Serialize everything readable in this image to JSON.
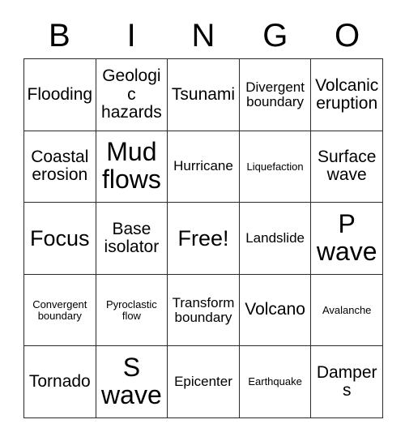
{
  "header": {
    "letters": [
      "B",
      "I",
      "N",
      "G",
      "O"
    ]
  },
  "grid": {
    "rows": 5,
    "columns": 5,
    "border_color": "#2b2b2b",
    "background_color": "#ffffff",
    "text_color": "#000000",
    "cells": [
      {
        "text": "Flooding",
        "size": "md"
      },
      {
        "text": "Geologic hazards",
        "size": "md"
      },
      {
        "text": "Tsunami",
        "size": "md"
      },
      {
        "text": "Divergent boundary",
        "size": "sm"
      },
      {
        "text": "Volcanic eruption",
        "size": "md"
      },
      {
        "text": "Coastal erosion",
        "size": "md"
      },
      {
        "text": "Mud flows",
        "size": "xl"
      },
      {
        "text": "Hurricane",
        "size": "sm"
      },
      {
        "text": "Liquefaction",
        "size": "xs"
      },
      {
        "text": "Surface wave",
        "size": "md"
      },
      {
        "text": "Focus",
        "size": "lg"
      },
      {
        "text": "Base isolator",
        "size": "md"
      },
      {
        "text": "Free!",
        "size": "lg"
      },
      {
        "text": "Landslide",
        "size": "sm"
      },
      {
        "text": "P wave",
        "size": "xl"
      },
      {
        "text": "Convergent boundary",
        "size": "xs"
      },
      {
        "text": "Pyroclastic flow",
        "size": "xs"
      },
      {
        "text": "Transform boundary",
        "size": "sm"
      },
      {
        "text": "Volcano",
        "size": "md"
      },
      {
        "text": "Avalanche",
        "size": "xs"
      },
      {
        "text": "Tornado",
        "size": "md"
      },
      {
        "text": "S wave",
        "size": "xl"
      },
      {
        "text": "Epicenter",
        "size": "sm"
      },
      {
        "text": "Earthquake",
        "size": "xs"
      },
      {
        "text": "Dampers",
        "size": "md"
      }
    ]
  }
}
